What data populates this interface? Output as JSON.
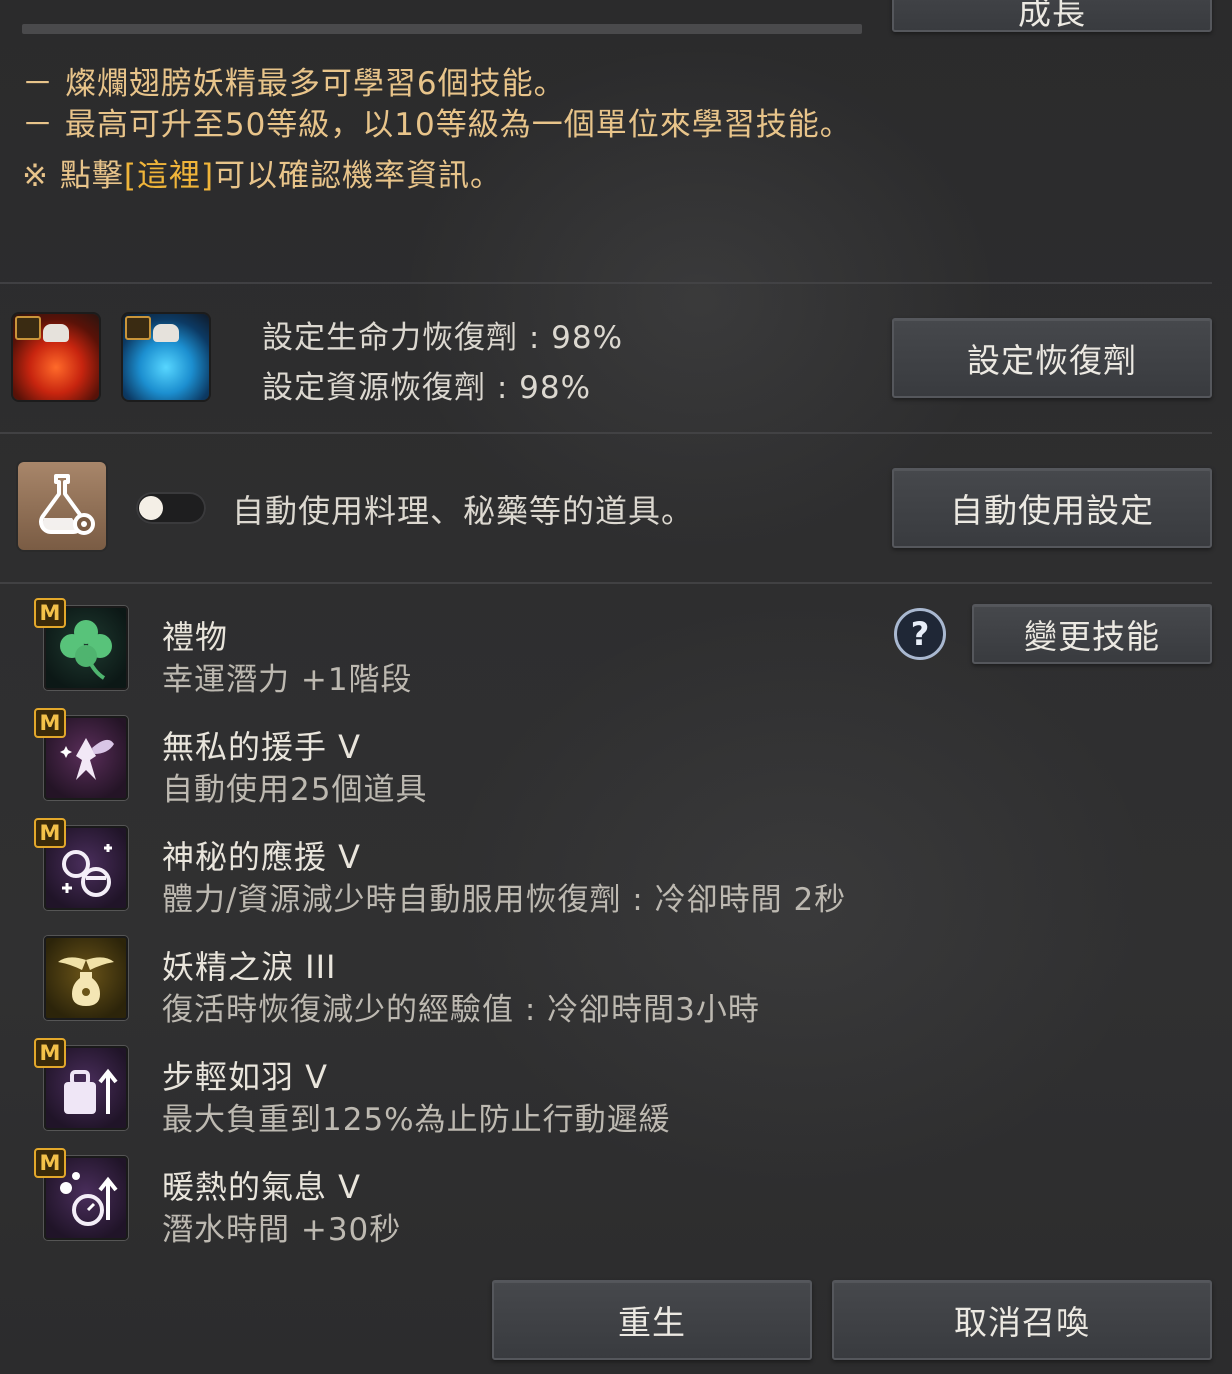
{
  "top": {
    "partial_button_label": "成長"
  },
  "notes": {
    "line1": "－ 燦爛翅膀妖精最多可學習6個技能。",
    "line2": "－ 最高可升至50等級，以10等級為一個單位來學習技能。",
    "line3_prefix": "※ 點擊",
    "line3_link": "[這裡]",
    "line3_suffix": "可以確認機率資訊。"
  },
  "recovery": {
    "hp_label": "設定生命力恢復劑 : 98%",
    "resource_label": "設定資源恢復劑 : 98%",
    "set_button": "設定恢復劑"
  },
  "auto_use": {
    "label": "自動使用料理、秘藥等的道具。",
    "toggle_on": false,
    "settings_button": "自動使用設定"
  },
  "skills": {
    "help_icon": "?",
    "change_button": "變更技能",
    "items": [
      {
        "badge": "M",
        "name": "禮物",
        "desc": "幸運潛力 +1階段",
        "icon": "clover-icon"
      },
      {
        "badge": "M",
        "name": "無私的援手 V",
        "desc": "自動使用25個道具",
        "icon": "fairy-icon"
      },
      {
        "badge": "M",
        "name": "神秘的應援 V",
        "desc": "體力/資源減少時自動服用恢復劑 : 冷卻時間 2秒",
        "icon": "potions-icon"
      },
      {
        "badge": "",
        "name": "妖精之淚 III",
        "desc": "復活時恢復減少的經驗值 : 冷卻時間3小時",
        "icon": "winged-vial-icon"
      },
      {
        "badge": "M",
        "name": "步輕如羽 V",
        "desc": "最大負重到125%為止防止行動遲緩",
        "icon": "weight-icon"
      },
      {
        "badge": "M",
        "name": "暖熱的氣息 V",
        "desc": "潛水時間 +30秒",
        "icon": "breath-icon"
      }
    ]
  },
  "footer": {
    "revive_button": "重生",
    "cancel_summon_button": "取消召喚"
  },
  "colors": {
    "note_text": "#e8c48a",
    "link_text": "#f0b53a",
    "badge_border": "#e3a82b"
  }
}
